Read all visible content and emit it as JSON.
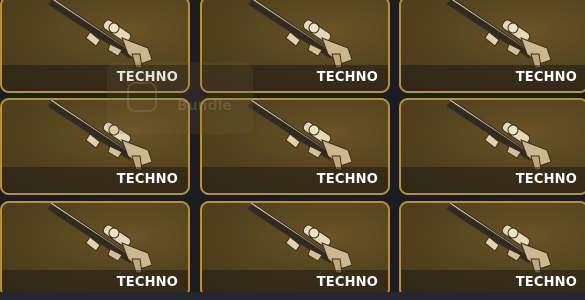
{
  "overlay": {
    "label": "Bundle",
    "icon": "bundle-icon"
  },
  "colors": {
    "card_border": "#b8912e",
    "card_fill": "#56451f",
    "background": "#1a1d24"
  },
  "weapon_icon": "sniper-rifle-icon",
  "items": [
    {
      "label": "TECHNO"
    },
    {
      "label": "TECHNO"
    },
    {
      "label": "TECHNO"
    },
    {
      "label": "TECHNO"
    },
    {
      "label": "TECHNO"
    },
    {
      "label": "TECHNO"
    },
    {
      "label": "TECHNO"
    },
    {
      "label": "TECHNO"
    },
    {
      "label": "TECHNO"
    }
  ]
}
